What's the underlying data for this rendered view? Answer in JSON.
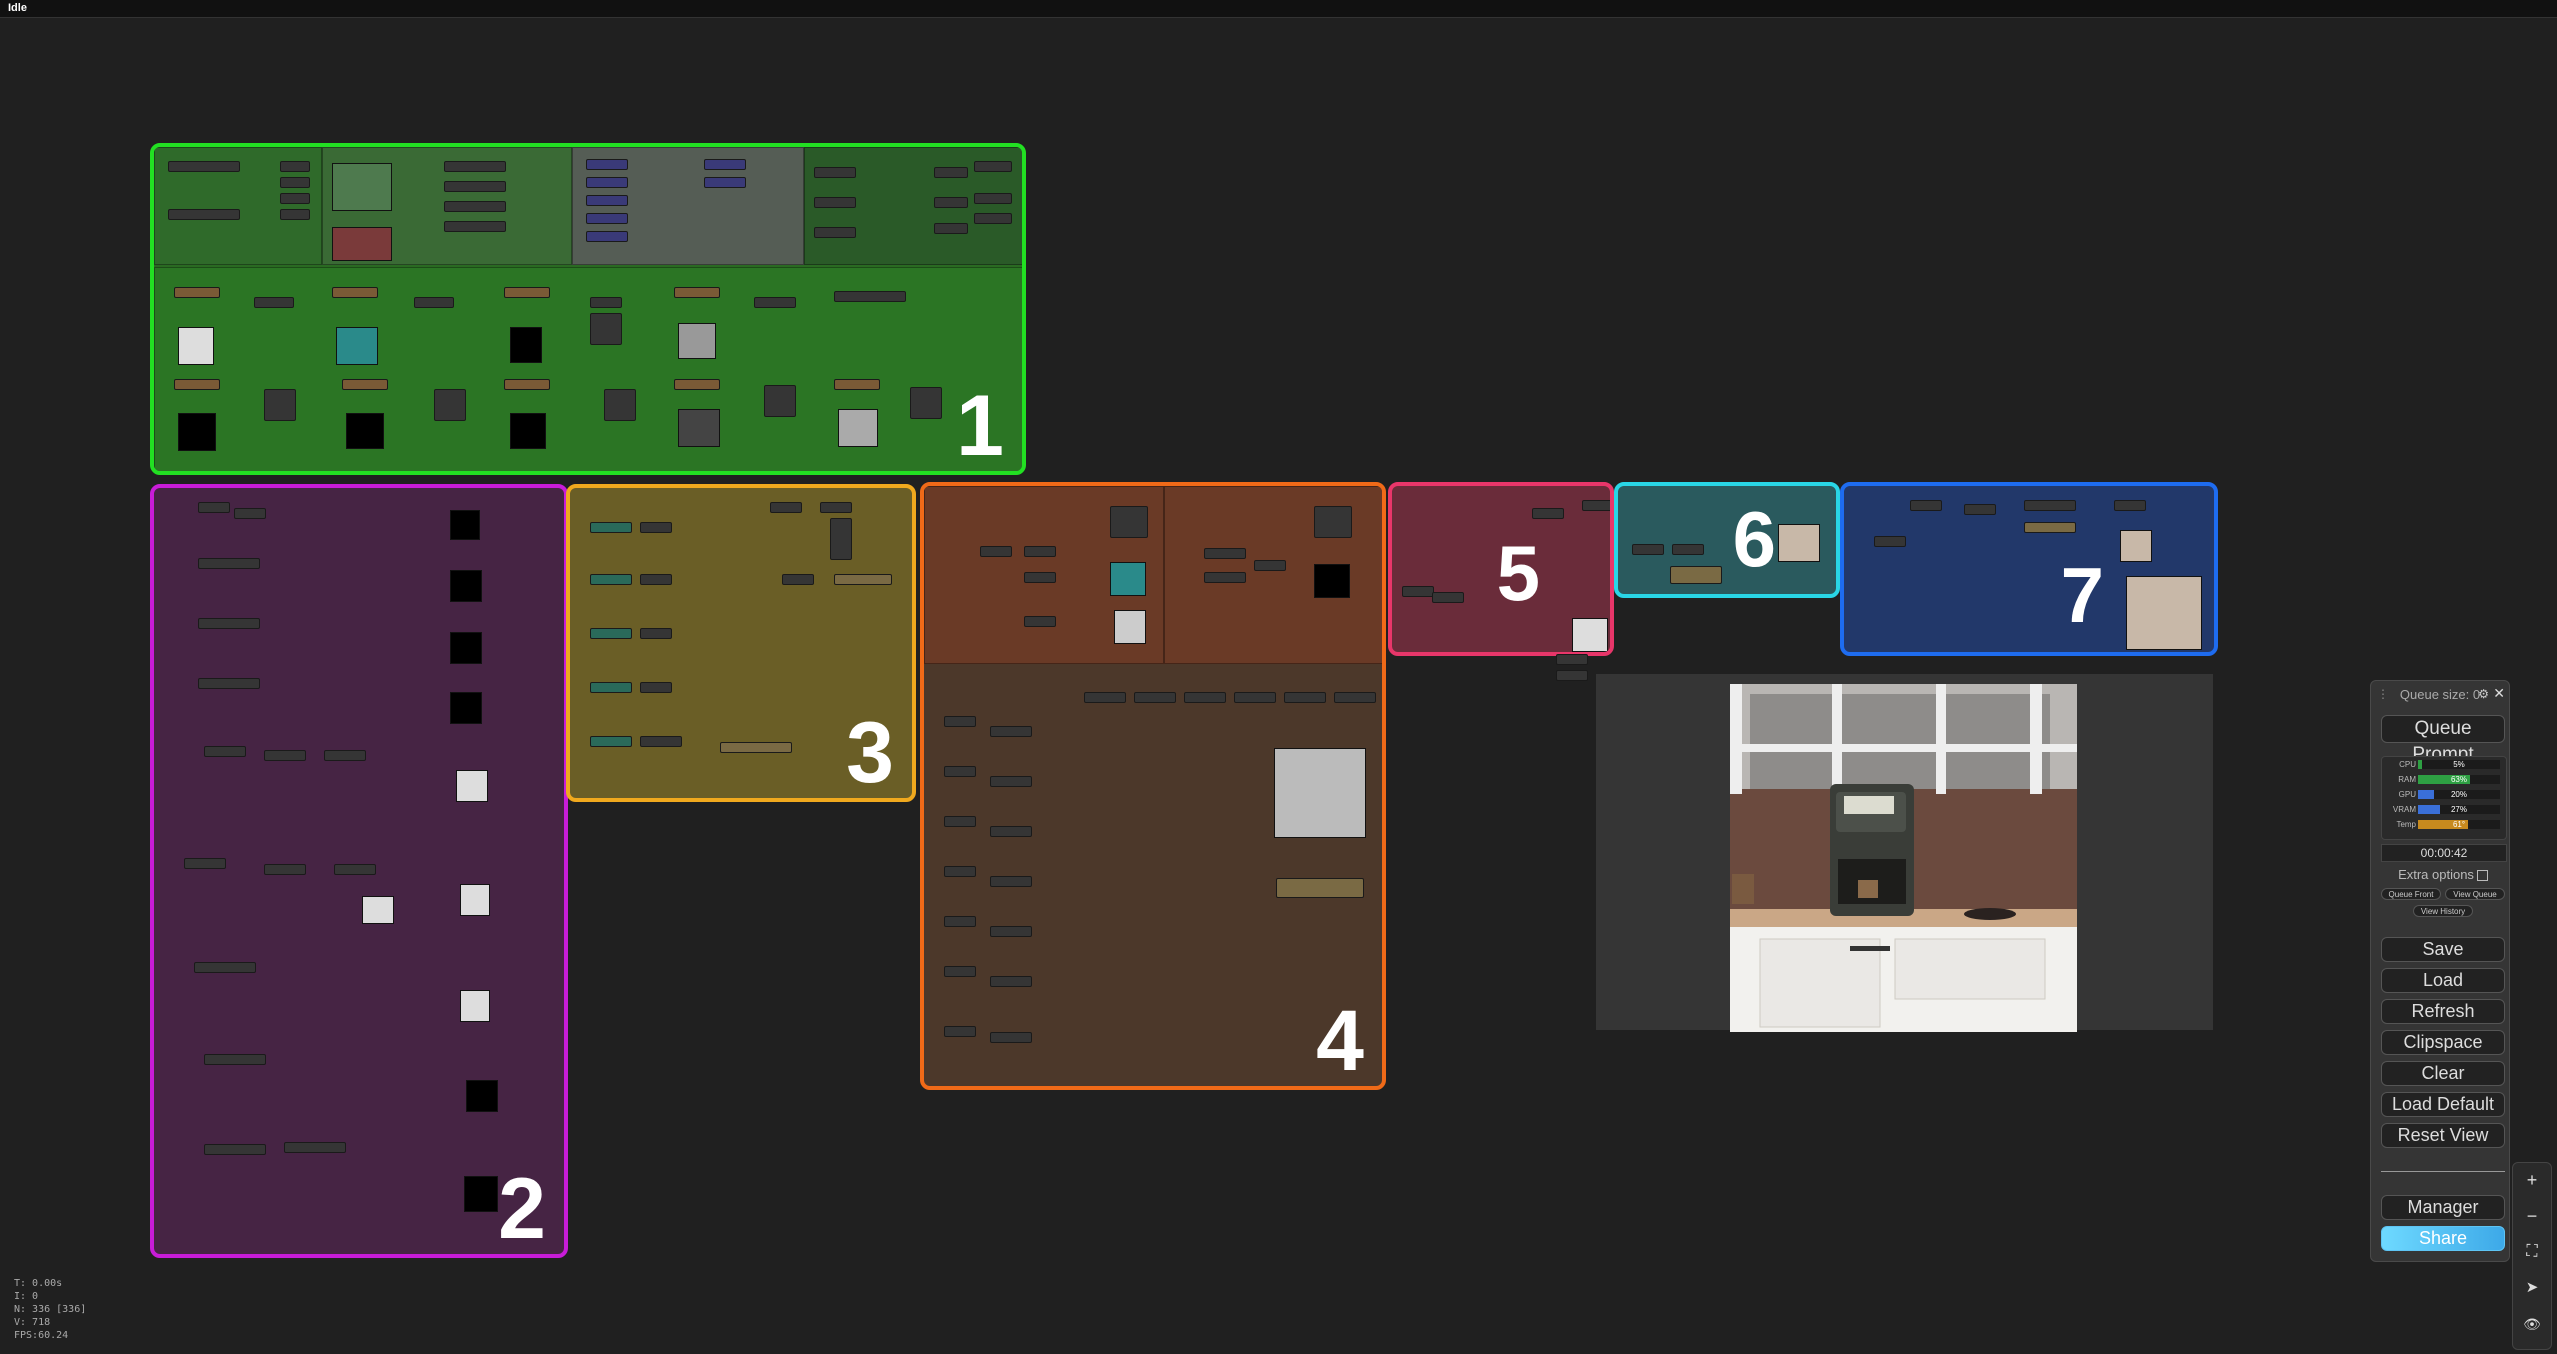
{
  "status": {
    "title": "Idle"
  },
  "groups": [
    {
      "number": "1",
      "color": "#22e022"
    },
    {
      "number": "2",
      "color": "#c81cd8"
    },
    {
      "number": "3",
      "color": "#f0a91e"
    },
    {
      "number": "4",
      "color": "#f06a18"
    },
    {
      "number": "5",
      "color": "#e8366a"
    },
    {
      "number": "6",
      "color": "#29d6e6"
    },
    {
      "number": "7",
      "color": "#1e6cf0"
    }
  ],
  "queue_panel": {
    "queue_size": "Queue size: 0",
    "queue_prompt": "Queue Prompt",
    "monitor": [
      {
        "label": "CPU",
        "value": "5%",
        "level": 5,
        "color": "#2ea043"
      },
      {
        "label": "RAM",
        "value": "63%",
        "level": 63,
        "color": "#2ea043"
      },
      {
        "label": "GPU",
        "value": "20%",
        "level": 20,
        "color": "#3a6fd8"
      },
      {
        "label": "VRAM",
        "value": "27%",
        "level": 27,
        "color": "#3a6fd8"
      },
      {
        "label": "Temp",
        "value": "61°",
        "level": 61,
        "color": "#c88a1e"
      }
    ],
    "timer": "00:00:42",
    "extra_options": "Extra options",
    "queue_front": "Queue Front",
    "view_queue": "View Queue",
    "view_history": "View History",
    "buttons": {
      "save": "Save",
      "load": "Load",
      "refresh": "Refresh",
      "clipspace": "Clipspace",
      "clear": "Clear",
      "load_default": "Load Default",
      "reset_view": "Reset View",
      "manager": "Manager",
      "share": "Share"
    }
  },
  "side_tools": {
    "zoom_in": "+",
    "zoom_out": "−",
    "fit": "⛶",
    "send": "➤",
    "eye": "👁"
  },
  "stats": {
    "t": "T: 0.00s",
    "i": "I: 0",
    "n": "N: 336 [336]",
    "v": "V: 718",
    "fps": "FPS:60.24"
  }
}
